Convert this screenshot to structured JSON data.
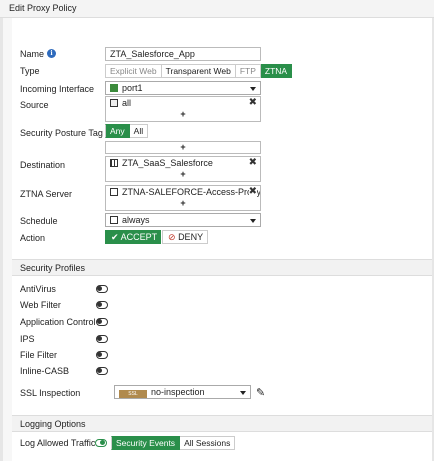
{
  "window": {
    "title": "Edit Proxy Policy"
  },
  "name": {
    "label": "Name",
    "value": "ZTA_Salesforce_App"
  },
  "type": {
    "label": "Type",
    "options": [
      "Explicit Web",
      "Transparent Web",
      "FTP",
      "ZTNA"
    ],
    "selected": "ZTNA"
  },
  "incoming_interface": {
    "label": "Incoming Interface",
    "value": "port1"
  },
  "source": {
    "label": "Source",
    "value": "all"
  },
  "posture": {
    "label": "Security Posture Tag",
    "options": [
      "Any",
      "All"
    ],
    "selected": "Any"
  },
  "destination": {
    "label": "Destination",
    "value": "ZTA_SaaS_Salesforce"
  },
  "ztna_server": {
    "label": "ZTNA Server",
    "value": "ZTNA-SALEFORCE-Access-Proxy"
  },
  "schedule": {
    "label": "Schedule",
    "value": "always"
  },
  "action": {
    "label": "Action",
    "accept": "ACCEPT",
    "deny": "DENY"
  },
  "security_profiles": {
    "title": "Security Profiles",
    "items": [
      {
        "label": "AntiVirus",
        "enabled": false
      },
      {
        "label": "Web Filter",
        "enabled": false
      },
      {
        "label": "Application Control",
        "enabled": false
      },
      {
        "label": "IPS",
        "enabled": false
      },
      {
        "label": "File Filter",
        "enabled": false
      },
      {
        "label": "Inline-CASB",
        "enabled": false
      }
    ],
    "ssl": {
      "label": "SSL Inspection",
      "badge": "SSL",
      "value": "no-inspection"
    }
  },
  "logging": {
    "title": "Logging Options",
    "label": "Log Allowed Traffic",
    "options": [
      "Security Events",
      "All Sessions"
    ],
    "selected": "Security Events",
    "enabled": true
  },
  "colors": {
    "accent": "#2a8f4a",
    "info": "#2f6bbd"
  }
}
